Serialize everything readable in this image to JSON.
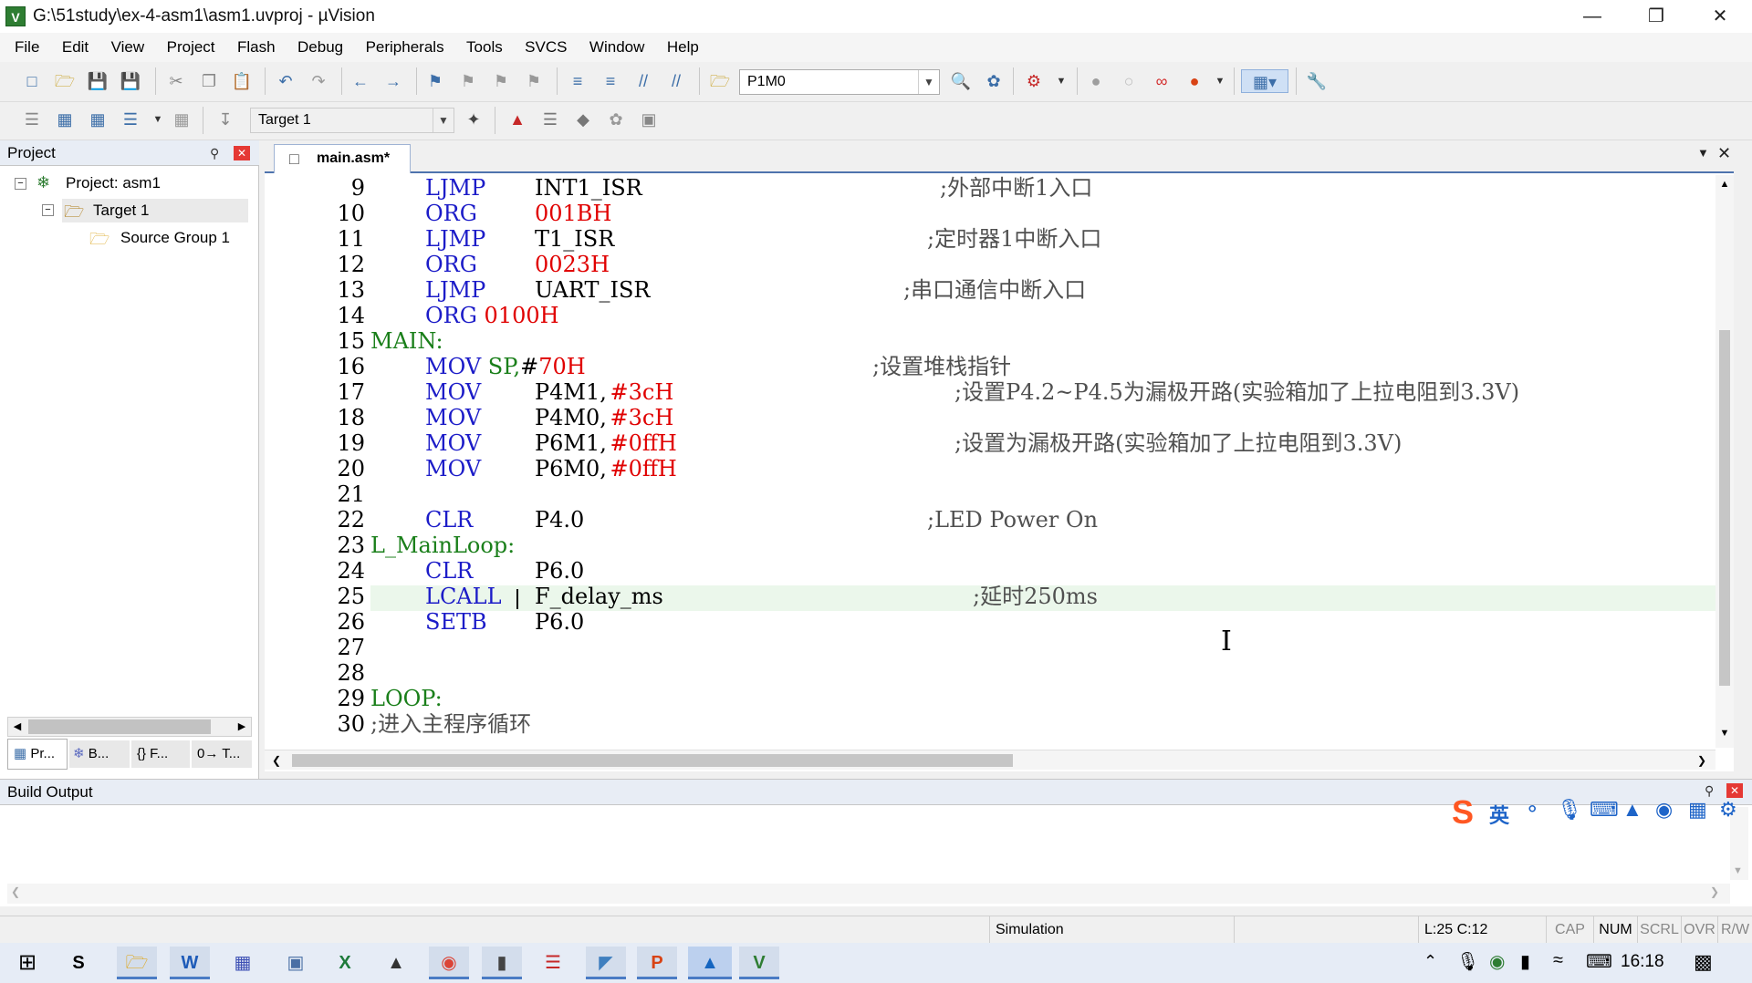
{
  "window": {
    "title": "G:\\51study\\ex-4-asm1\\asm1.uvproj - µVision"
  },
  "menu": [
    "File",
    "Edit",
    "View",
    "Project",
    "Flash",
    "Debug",
    "Peripherals",
    "Tools",
    "SVCS",
    "Window",
    "Help"
  ],
  "toolbar1": {
    "find_combo_value": "P1M0"
  },
  "toolbar2": {
    "target_value": "Target 1"
  },
  "project_panel": {
    "title": "Project",
    "tree": [
      {
        "label": "Project: asm1"
      },
      {
        "label": "Target 1"
      },
      {
        "label": "Source Group 1"
      }
    ],
    "bottom_tabs": [
      "Pr...",
      "B...",
      "{} F...",
      "0→ T..."
    ]
  },
  "editor": {
    "tab_label": "main.asm*",
    "lines": [
      {
        "n": "9",
        "indent": true,
        "op": "LJMP",
        "arg": "INT1_ISR",
        "cm": ";外部中断1入口"
      },
      {
        "n": "10",
        "indent": true,
        "op": "ORG",
        "num": "001BH"
      },
      {
        "n": "11",
        "indent": true,
        "op": "LJMP",
        "arg": "T1_ISR",
        "cm": ";定时器1中断入口"
      },
      {
        "n": "12",
        "indent": true,
        "op": "ORG",
        "num": "0023H"
      },
      {
        "n": "13",
        "indent": true,
        "op": "LJMP",
        "arg": "UART_ISR",
        "cm": ";串口通信中断入口"
      },
      {
        "n": "14",
        "indent": true,
        "op": "ORG 0100H"
      },
      {
        "n": "15",
        "label": "MAIN:"
      },
      {
        "n": "16",
        "indent": true,
        "op": "MOV SP,#70H",
        "cm": ";设置堆栈指针"
      },
      {
        "n": "17",
        "indent": true,
        "op": "MOV",
        "arg": "P4M1,",
        "num": "#3cH",
        "cm": ";设置P4.2~P4.5为漏极开路(实验箱加了上拉电阻到3.3V)"
      },
      {
        "n": "18",
        "indent": true,
        "op": "MOV",
        "arg": "P4M0,",
        "num": "#3cH"
      },
      {
        "n": "19",
        "indent": true,
        "op": "MOV",
        "arg": "P6M1,",
        "num": "#0ffH",
        "cm": ";设置为漏极开路(实验箱加了上拉电阻到3.3V)"
      },
      {
        "n": "20",
        "indent": true,
        "op": "MOV",
        "arg": "P6M0,",
        "num": "#0ffH"
      },
      {
        "n": "21"
      },
      {
        "n": "22",
        "indent": true,
        "op": "CLR",
        "arg": "P4.0",
        "cm": ";LED Power On"
      },
      {
        "n": "23",
        "label": "L_MainLoop:"
      },
      {
        "n": "24",
        "indent": true,
        "op": "CLR",
        "arg": "P6.0"
      },
      {
        "n": "25",
        "indent": true,
        "op": "LCALL",
        "arg": "F_delay_ms",
        "cm": ";延时250ms"
      },
      {
        "n": "26",
        "indent": true,
        "op": "SETB",
        "arg": "P6.0"
      },
      {
        "n": "27"
      },
      {
        "n": "28"
      },
      {
        "n": "29",
        "label": "LOOP:"
      },
      {
        "n": "30",
        "cm_line": ";进入主程序循环"
      }
    ]
  },
  "build_output": {
    "title": "Build Output"
  },
  "ime_toolbar": {
    "mode": "英"
  },
  "statusbar": {
    "mode": "Simulation",
    "position": "L:25 C:12",
    "indicators": [
      "CAP",
      "NUM",
      "SCRL",
      "OVR",
      "R/W"
    ]
  },
  "taskbar": {
    "clock": "16:18"
  }
}
